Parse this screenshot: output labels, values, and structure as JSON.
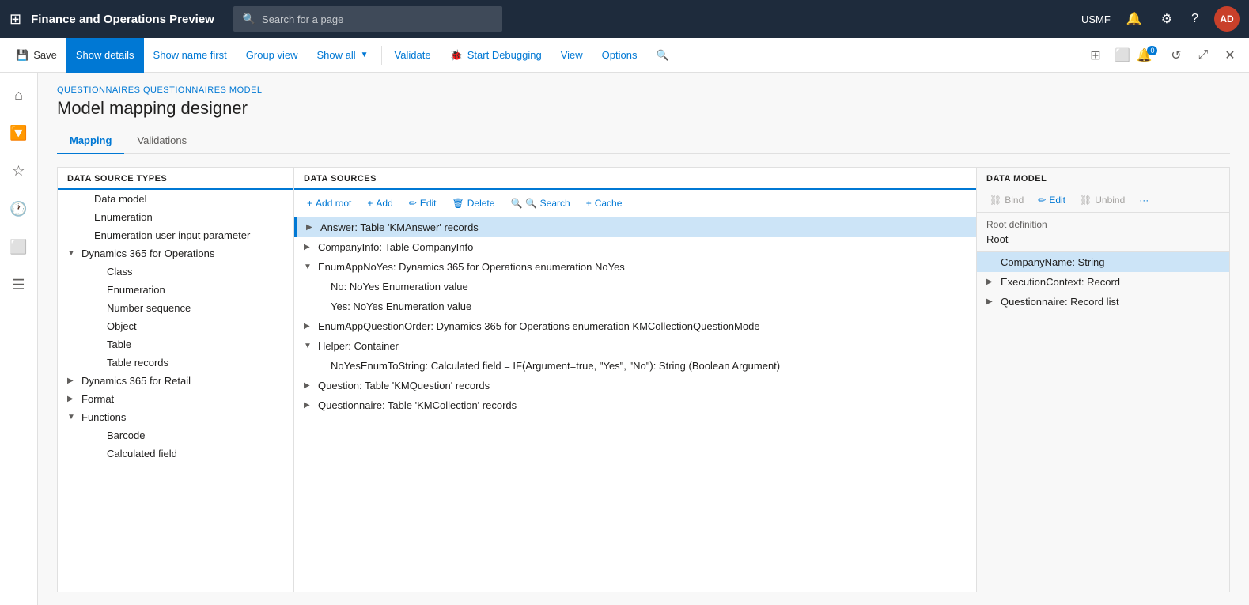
{
  "app": {
    "title": "Finance and Operations Preview",
    "search_placeholder": "Search for a page",
    "user": "USMF",
    "avatar": "AD"
  },
  "toolbar": {
    "save_label": "Save",
    "show_details_label": "Show details",
    "show_name_first_label": "Show name first",
    "group_view_label": "Group view",
    "show_all_label": "Show all",
    "validate_label": "Validate",
    "start_debugging_label": "Start Debugging",
    "view_label": "View",
    "options_label": "Options"
  },
  "breadcrumb": "QUESTIONNAIRES QUESTIONNAIRES MODEL",
  "page_title": "Model mapping designer",
  "tabs": [
    {
      "label": "Mapping",
      "active": true
    },
    {
      "label": "Validations",
      "active": false
    }
  ],
  "left_panel": {
    "header": "DATA SOURCE TYPES",
    "items": [
      {
        "label": "Data model",
        "indent": 1,
        "expand": false
      },
      {
        "label": "Enumeration",
        "indent": 1,
        "expand": false
      },
      {
        "label": "Enumeration user input parameter",
        "indent": 1,
        "expand": false
      },
      {
        "label": "Dynamics 365 for Operations",
        "indent": 0,
        "expand": true,
        "expanded": true
      },
      {
        "label": "Class",
        "indent": 2,
        "expand": false
      },
      {
        "label": "Enumeration",
        "indent": 2,
        "expand": false
      },
      {
        "label": "Number sequence",
        "indent": 2,
        "expand": false
      },
      {
        "label": "Object",
        "indent": 2,
        "expand": false
      },
      {
        "label": "Table",
        "indent": 2,
        "expand": false
      },
      {
        "label": "Table records",
        "indent": 2,
        "expand": false
      },
      {
        "label": "Dynamics 365 for Retail",
        "indent": 0,
        "expand": true,
        "expanded": false
      },
      {
        "label": "Format",
        "indent": 0,
        "expand": true,
        "expanded": false
      },
      {
        "label": "Functions",
        "indent": 0,
        "expand": true,
        "expanded": true
      },
      {
        "label": "Barcode",
        "indent": 2,
        "expand": false
      },
      {
        "label": "Calculated field",
        "indent": 2,
        "expand": false
      }
    ]
  },
  "middle_panel": {
    "header": "DATA SOURCES",
    "toolbar": {
      "add_root": "+ Add root",
      "add": "+ Add",
      "edit": "✏ Edit",
      "delete": "🗑 Delete",
      "search": "🔍 Search",
      "cache": "+ Cache"
    },
    "items": [
      {
        "label": "Answer: Table 'KMAnswer' records",
        "indent": 0,
        "expand": true,
        "expanded": false,
        "selected": true
      },
      {
        "label": "CompanyInfo: Table CompanyInfo",
        "indent": 0,
        "expand": true,
        "expanded": false
      },
      {
        "label": "EnumAppNoYes: Dynamics 365 for Operations enumeration NoYes",
        "indent": 0,
        "expand": true,
        "expanded": true
      },
      {
        "label": "No: NoYes Enumeration value",
        "indent": 1,
        "expand": false
      },
      {
        "label": "Yes: NoYes Enumeration value",
        "indent": 1,
        "expand": false
      },
      {
        "label": "EnumAppQuestionOrder: Dynamics 365 for Operations enumeration KMCollectionQuestionMode",
        "indent": 0,
        "expand": true,
        "expanded": false
      },
      {
        "label": "Helper: Container",
        "indent": 0,
        "expand": true,
        "expanded": true
      },
      {
        "label": "NoYesEnumToString: Calculated field = IF(Argument=true, \"Yes\", \"No\"): String (Boolean Argument)",
        "indent": 1,
        "expand": false
      },
      {
        "label": "Question: Table 'KMQuestion' records",
        "indent": 0,
        "expand": true,
        "expanded": false
      },
      {
        "label": "Questionnaire: Table 'KMCollection' records",
        "indent": 0,
        "expand": true,
        "expanded": false
      }
    ]
  },
  "right_panel": {
    "header": "DATA MODEL",
    "toolbar": {
      "bind": "Bind",
      "edit": "Edit",
      "unbind": "Unbind"
    },
    "root_definition_label": "Root definition",
    "root_value": "Root",
    "items": [
      {
        "label": "CompanyName: String",
        "indent": 0,
        "expand": false,
        "selected": true
      },
      {
        "label": "ExecutionContext: Record",
        "indent": 0,
        "expand": true,
        "expanded": false
      },
      {
        "label": "Questionnaire: Record list",
        "indent": 0,
        "expand": true,
        "expanded": false
      }
    ]
  }
}
